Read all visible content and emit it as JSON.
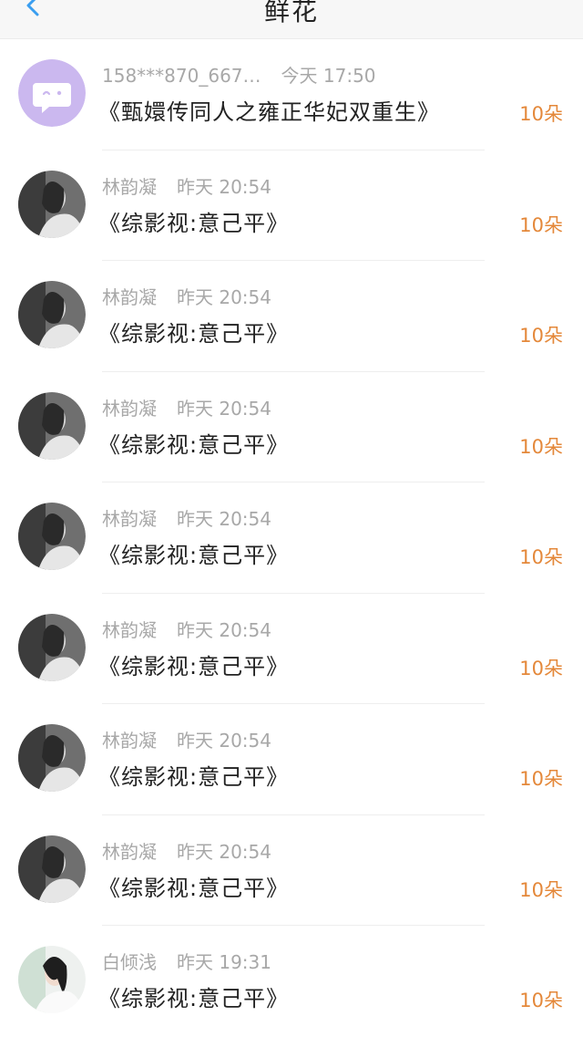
{
  "header": {
    "title": "鲜花",
    "back_icon": "chevron-left-icon",
    "accent": "#3a9ef0"
  },
  "colors": {
    "count": "#e4883a",
    "meta": "#a8a8a8",
    "title": "#222222"
  },
  "items": [
    {
      "user": "158***870_667…",
      "time": "今天 17:50",
      "book": "《甄嬛传同人之雍正华妃双重生》",
      "count": "10朵",
      "avatar": "default-purple-avatar"
    },
    {
      "user": "林韵凝",
      "time": "昨天 20:54",
      "book": "《综影视:意己平》",
      "count": "10朵",
      "avatar": "bw-portrait-avatar"
    },
    {
      "user": "林韵凝",
      "time": "昨天 20:54",
      "book": "《综影视:意己平》",
      "count": "10朵",
      "avatar": "bw-portrait-avatar"
    },
    {
      "user": "林韵凝",
      "time": "昨天 20:54",
      "book": "《综影视:意己平》",
      "count": "10朵",
      "avatar": "bw-portrait-avatar"
    },
    {
      "user": "林韵凝",
      "time": "昨天 20:54",
      "book": "《综影视:意己平》",
      "count": "10朵",
      "avatar": "bw-portrait-avatar"
    },
    {
      "user": "林韵凝",
      "time": "昨天 20:54",
      "book": "《综影视:意己平》",
      "count": "10朵",
      "avatar": "bw-portrait-avatar"
    },
    {
      "user": "林韵凝",
      "time": "昨天 20:54",
      "book": "《综影视:意己平》",
      "count": "10朵",
      "avatar": "bw-portrait-avatar"
    },
    {
      "user": "林韵凝",
      "time": "昨天 20:54",
      "book": "《综影视:意己平》",
      "count": "10朵",
      "avatar": "bw-portrait-avatar"
    },
    {
      "user": "白倾浅",
      "time": "昨天 19:31",
      "book": "《综影视:意己平》",
      "count": "10朵",
      "avatar": "photo-avatar"
    }
  ]
}
